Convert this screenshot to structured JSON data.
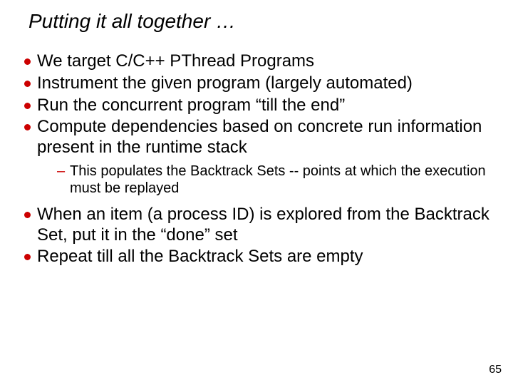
{
  "title": "Putting it all together …",
  "bullets_a": {
    "b0": "We target C/C++ PThread Programs",
    "b1": "Instrument the given program (largely automated)",
    "b2": "Run the concurrent program “till the end”",
    "b3": "Compute dependencies based on concrete run information present in the runtime stack"
  },
  "sub": {
    "s0": "This populates the Backtrack Sets  -- points at which the execution must be replayed"
  },
  "bullets_b": {
    "b4": "When an item (a process ID) is explored from the Backtrack Set, put it in the “done” set",
    "b5": "Repeat till all the Backtrack Sets are empty"
  },
  "page_number": "65"
}
